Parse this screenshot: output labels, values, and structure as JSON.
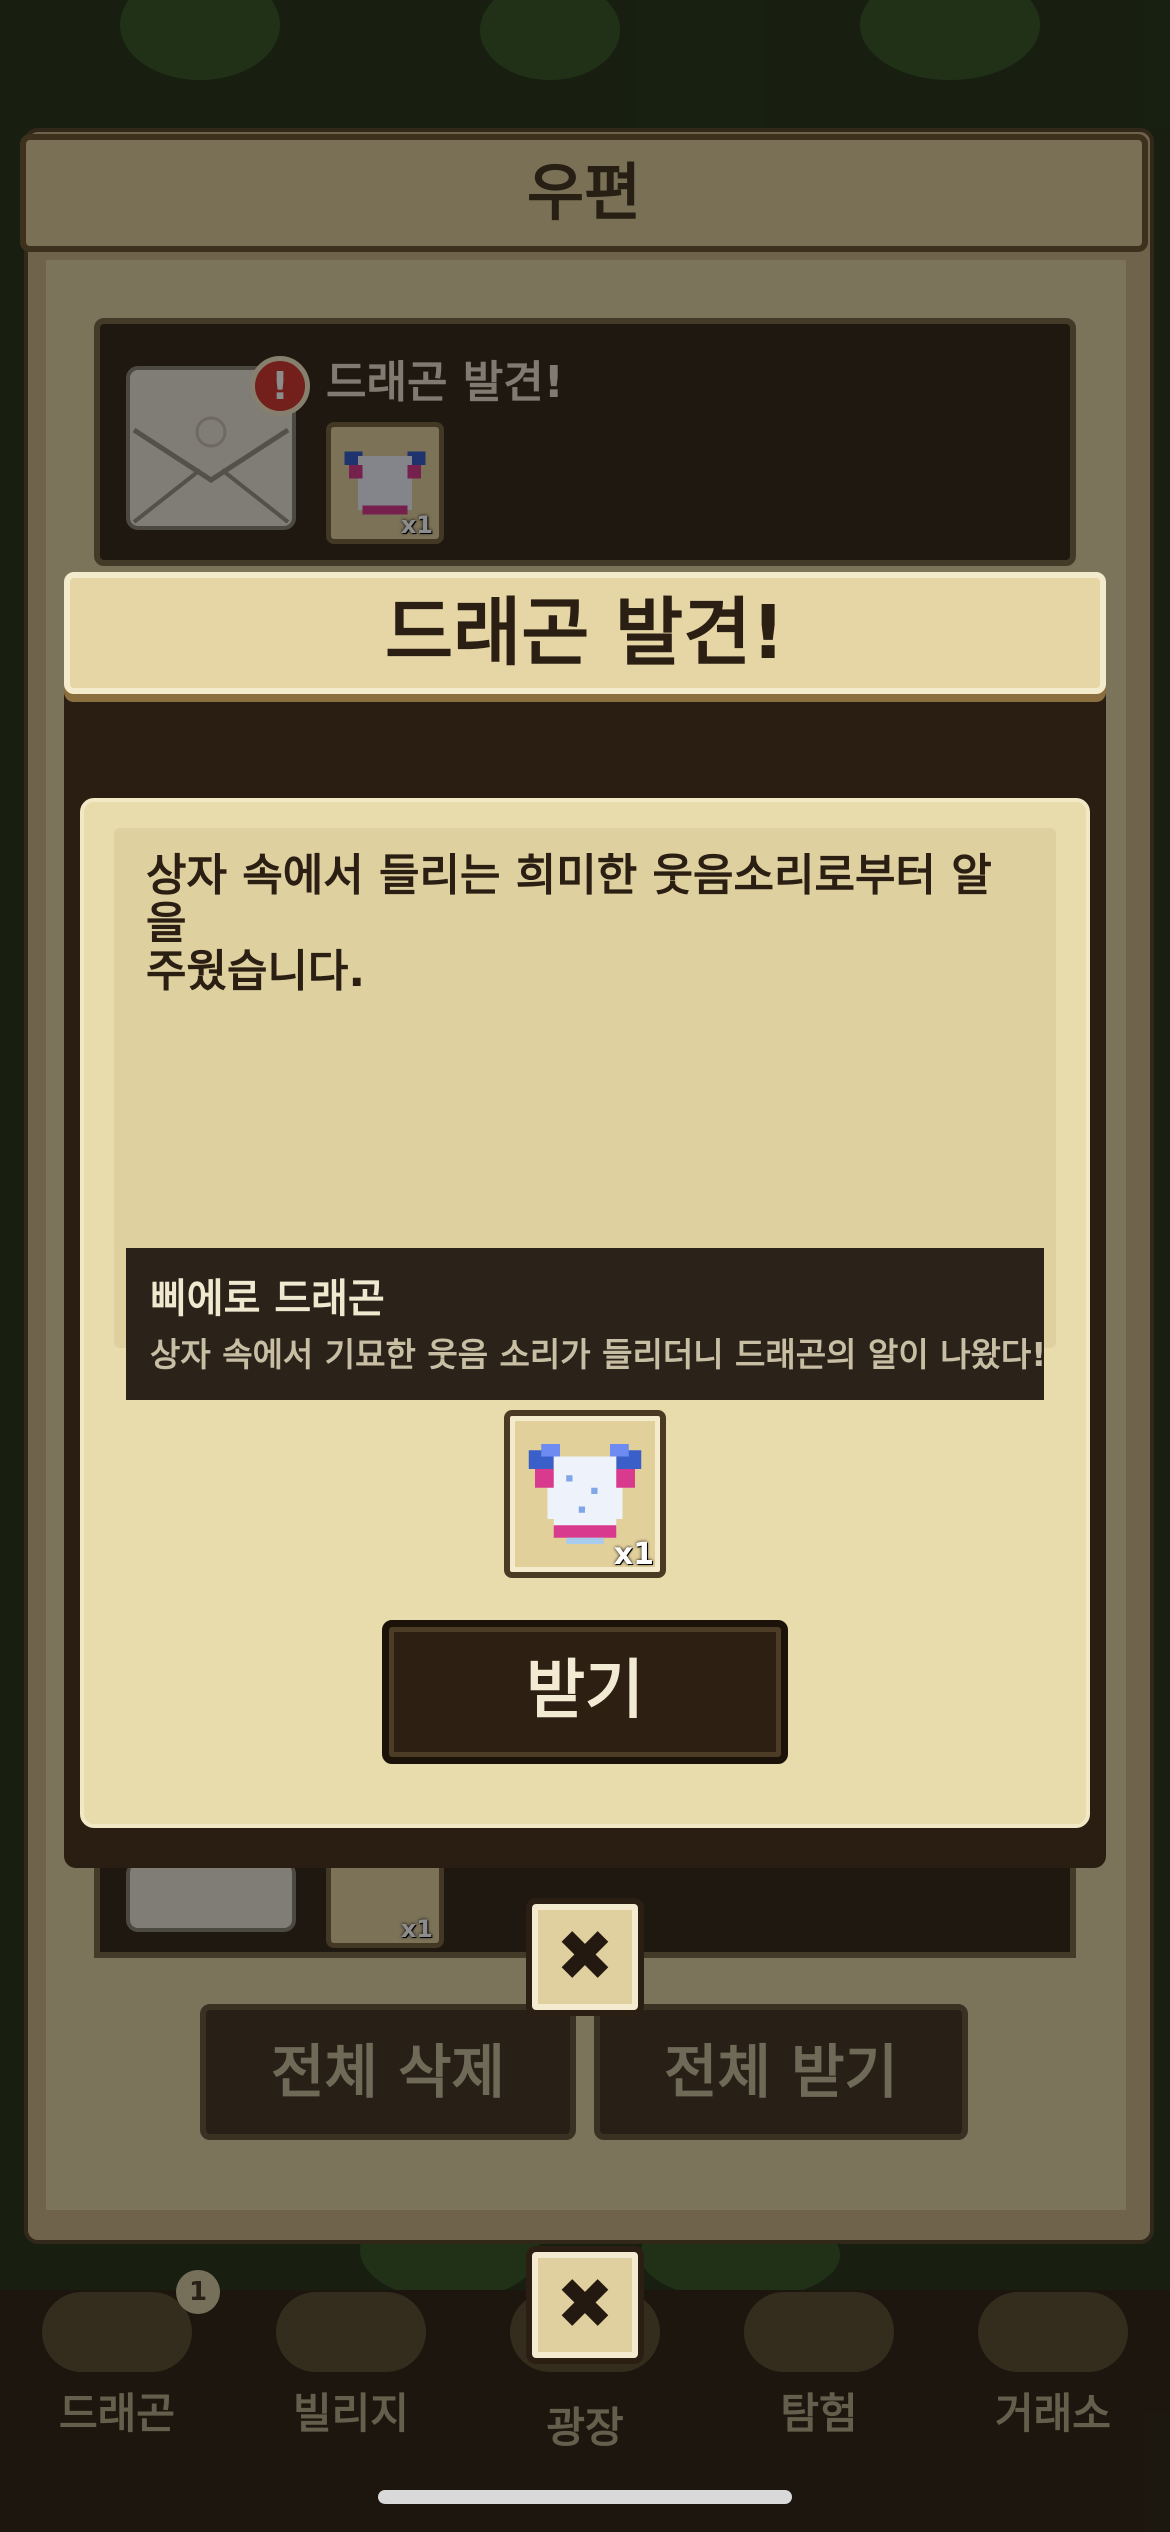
{
  "mailbox": {
    "title": "우편",
    "mail_item_title": "드래곤 발견!",
    "mail_item_qty": "x1",
    "second_item_qty": "x1",
    "delete_all_label": "전체 삭제",
    "receive_all_label": "전체 받기"
  },
  "tabs": [
    {
      "label": "드래곤",
      "badge": "1",
      "icon": "dragon-icon"
    },
    {
      "label": "빌리지",
      "icon": "village-icon"
    },
    {
      "label": "광장",
      "icon": "plaza-icon"
    },
    {
      "label": "탐험",
      "icon": "compass-icon"
    },
    {
      "label": "거래소",
      "icon": "market-icon"
    }
  ],
  "dialog": {
    "title": "드래곤 발견!",
    "message_line1": "상자 속에서 들리는 희미한 웃음소리로부터 알을",
    "message_line2": "주웠습니다.",
    "item_name": "삐에로 드래곤",
    "item_description": "상자 속에서 기묘한 웃음 소리가 들리더니 드래곤의 알이 나왔다!",
    "reward_qty": "x1",
    "receive_label": "받기"
  },
  "colors": {
    "accent_red": "#d23a33",
    "panel_dark": "#2b1f14",
    "parchment": "#e8dbac"
  }
}
